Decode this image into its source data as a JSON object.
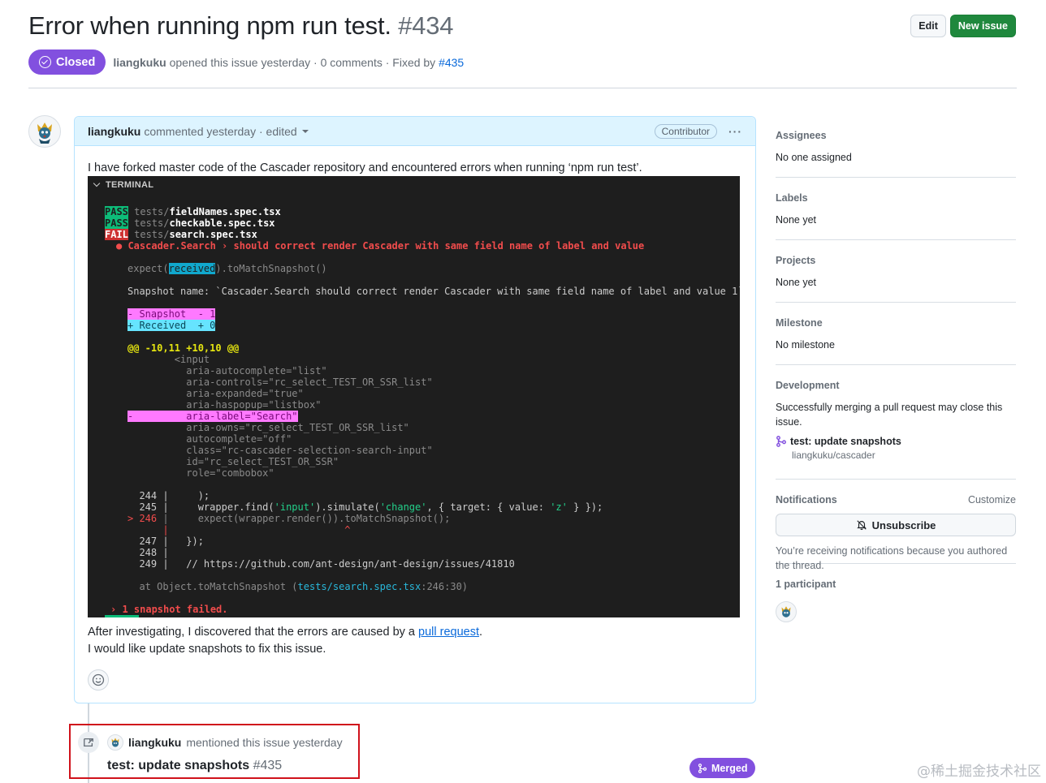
{
  "issue": {
    "title": "Error when running npm run test.",
    "number": "#434",
    "state": "Closed",
    "author": "liangkuku",
    "meta_text": "opened this issue yesterday · 0 comments · Fixed by",
    "fixed_by": "#435"
  },
  "actions": {
    "edit": "Edit",
    "new_issue": "New issue"
  },
  "comment": {
    "author": "liangkuku",
    "meta": "commented yesterday · edited",
    "role": "Contributor",
    "menu": "···",
    "intro": "I have forked master code of the Cascader repository and encountered errors when running ‘npm run test’.",
    "terminal_title": "TERMINAL",
    "after_1a": "After investigating, I discovered that the errors are caused by a",
    "after_link": "pull request",
    "after_1b": ".",
    "after_2": "I would like update snapshots to fix this issue."
  },
  "terminal": {
    "pass": "PASS",
    "fail": "FAIL",
    "tests_prefix": " tests/",
    "file1": "fieldNames.spec.tsx",
    "file2": "checkable.spec.tsx",
    "file3": "search.spec.tsx",
    "fail_line": "● Cascader.Search › should correct render Cascader with same field name of label and value",
    "expect_a": "expect(",
    "expect_received": "received",
    "expect_b": ").toMatchSnapshot()",
    "snapshot_name": "Snapshot name: `Cascader.Search should correct render Cascader with same field name of label and value 1`",
    "snap_minus": "- Snapshot  - 1",
    "snap_plus": "+ Received  + 0",
    "hunk": "@@ -10,11 +10,10 @@",
    "l_input": "        <input",
    "l_auto": "          aria-autocomplete=\"list\"",
    "l_controls": "          aria-controls=\"rc_select_TEST_OR_SSR_list\"",
    "l_expanded": "          aria-expanded=\"true\"",
    "l_haspopup": "          aria-haspopup=\"listbox\"",
    "l_label": "-         aria-label=\"Search\"",
    "l_owns": "          aria-owns=\"rc_select_TEST_OR_SSR_list\"",
    "l_autocomplete": "          autocomplete=\"off\"",
    "l_class": "          class=\"rc-cascader-selection-search-input\"",
    "l_id": "          id=\"rc_select_TEST_OR_SSR\"",
    "l_role": "          role=\"combobox\"",
    "c244": "  244 |     );",
    "c245a": "  245 |     wrapper.find(",
    "c245s1": "'input'",
    "c245b": ").simulate(",
    "c245s2": "'change'",
    "c245c": ", { target: { value: ",
    "c245s3": "'z'",
    "c245d": " } });",
    "c246a": "> 246",
    "c246b": " |     expect(wrapper.render()).toMatchSnapshot();",
    "c_caret": "      |                              ^",
    "c247": "  247 |   });",
    "c248": "  248 |",
    "c249": "  249 |   // https://github.com/ant-design/ant-design/issues/41810",
    "at_a": "  at Object.toMatchSnapshot (",
    "at_file": "tests/search.spec.tsx",
    "at_b": ":246:30)",
    "summary": "› 1 snapshot failed."
  },
  "event": {
    "author": "liangkuku",
    "text": "mentioned this issue yesterday",
    "pr_title": "test: update snapshots",
    "pr_number": "#435",
    "pr_state": "Merged"
  },
  "sidebar": {
    "assignees": {
      "label": "Assignees",
      "value": "No one assigned"
    },
    "labels": {
      "label": "Labels",
      "value": "None yet"
    },
    "projects": {
      "label": "Projects",
      "value": "None yet"
    },
    "milestone": {
      "label": "Milestone",
      "value": "No milestone"
    },
    "development": {
      "label": "Development",
      "value": "Successfully merging a pull request may close this issue.",
      "pr_title": "test: update snapshots",
      "pr_repo": "liangkuku/cascader"
    },
    "notifications": {
      "label": "Notifications",
      "customize": "Customize",
      "unsubscribe": "Unsubscribe",
      "note": "You’re receiving notifications because you authored the thread."
    },
    "participants": {
      "label": "1 participant"
    }
  },
  "watermark": "@稀土掘金技术社区",
  "colors": {
    "closed": "#8250df",
    "link": "#0969da",
    "primary_button": "#1f883d",
    "highlight": "#d0121b"
  }
}
